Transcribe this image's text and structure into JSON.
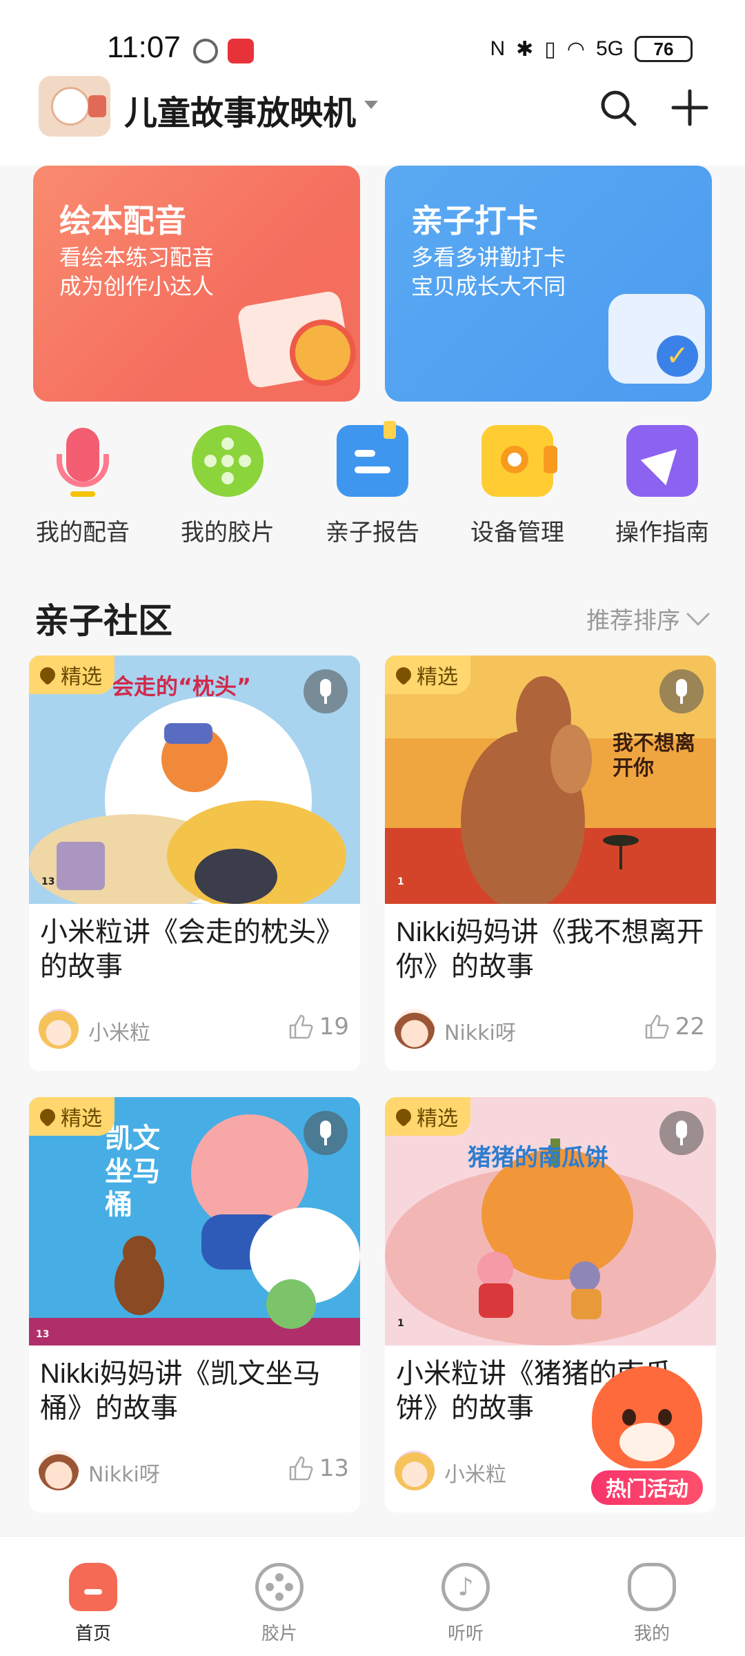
{
  "status_bar": {
    "time": "11:07",
    "battery": "76",
    "network": "5G"
  },
  "header": {
    "app_title": "儿童故事放映机"
  },
  "banners": [
    {
      "title": "绘本配音",
      "line1": "看绘本练习配音",
      "line2": "成为创作小达人"
    },
    {
      "title": "亲子打卡",
      "line1": "多看多讲勤打卡",
      "line2": "宝贝成长大不同"
    }
  ],
  "quick_actions": [
    {
      "label": "我的配音",
      "icon": "microphone-icon"
    },
    {
      "label": "我的胶片",
      "icon": "film-reel-icon"
    },
    {
      "label": "亲子报告",
      "icon": "report-icon"
    },
    {
      "label": "设备管理",
      "icon": "projector-icon"
    },
    {
      "label": "操作指南",
      "icon": "guide-arrow-icon"
    }
  ],
  "community": {
    "title": "亲子社区",
    "sort_label": "推荐排序"
  },
  "cards": [
    {
      "badge": "精选",
      "title": "小米粒讲《会走的枕头》的故事",
      "author": "小米粒",
      "likes": "19",
      "cover_text": "会走的“枕头”",
      "page": "13"
    },
    {
      "badge": "精选",
      "title": "Nikki妈妈讲《我不想离开你》的故事",
      "author": "Nikki呀",
      "likes": "22",
      "cover_text": "我不想离开你",
      "page": "1"
    },
    {
      "badge": "精选",
      "title": "Nikki妈妈讲《凯文坐马桶》的故事",
      "author": "Nikki呀",
      "likes": "13",
      "cover_text": "凯文坐马桶",
      "page": "13"
    },
    {
      "badge": "精选",
      "title": "小米粒讲《猪猪的南瓜饼》的故事",
      "author": "小米粒",
      "likes": "",
      "cover_text": "猪猪的南瓜饼",
      "page": "1"
    }
  ],
  "floating_activity": {
    "label": "热门活动"
  },
  "bottom_nav": [
    {
      "label": "首页",
      "active": true
    },
    {
      "label": "胶片",
      "active": false
    },
    {
      "label": "听听",
      "active": false
    },
    {
      "label": "我的",
      "active": false
    }
  ],
  "colors": {
    "banner_left": "#f56f5f",
    "banner_right": "#4b9bf0",
    "badge": "#ffd76e",
    "activity": "#f7346a"
  }
}
